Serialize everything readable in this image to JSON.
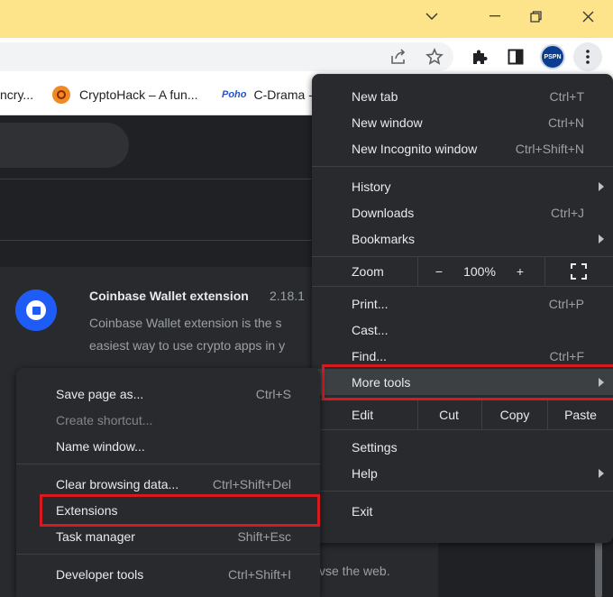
{
  "titlebar": {
    "color": "#fde48a"
  },
  "bookmarks": [
    {
      "label": "ncry..."
    },
    {
      "label": "CryptoHack – A fun..."
    },
    {
      "badge": "Poho",
      "label": "C-Drama -"
    }
  ],
  "extension": {
    "name": "Coinbase Wallet extension",
    "version": "2.18.1",
    "desc_line1": "Coinbase Wallet extension is the s",
    "desc_line2": "easiest way to use crypto apps in y",
    "bottom_text": "vse the web."
  },
  "toolbar": {
    "profile_badge": "PSPN"
  },
  "main_menu": {
    "new_tab": {
      "label": "New tab",
      "shortcut": "Ctrl+T"
    },
    "new_window": {
      "label": "New window",
      "shortcut": "Ctrl+N"
    },
    "new_incognito": {
      "label": "New Incognito window",
      "shortcut": "Ctrl+Shift+N"
    },
    "history": {
      "label": "History"
    },
    "downloads": {
      "label": "Downloads",
      "shortcut": "Ctrl+J"
    },
    "bookmarks": {
      "label": "Bookmarks"
    },
    "zoom": {
      "label": "Zoom",
      "minus": "−",
      "value": "100%",
      "plus": "+"
    },
    "print": {
      "label": "Print...",
      "shortcut": "Ctrl+P"
    },
    "cast": {
      "label": "Cast..."
    },
    "find": {
      "label": "Find...",
      "shortcut": "Ctrl+F"
    },
    "more_tools": {
      "label": "More tools"
    },
    "edit": {
      "label": "Edit",
      "cut": "Cut",
      "copy": "Copy",
      "paste": "Paste"
    },
    "settings": {
      "label": "Settings"
    },
    "help": {
      "label": "Help"
    },
    "exit": {
      "label": "Exit"
    }
  },
  "submenu": {
    "save_page": {
      "label": "Save page as...",
      "shortcut": "Ctrl+S"
    },
    "create_shortcut": {
      "label": "Create shortcut..."
    },
    "name_window": {
      "label": "Name window..."
    },
    "clear_data": {
      "label": "Clear browsing data...",
      "shortcut": "Ctrl+Shift+Del"
    },
    "extensions": {
      "label": "Extensions"
    },
    "task_manager": {
      "label": "Task manager",
      "shortcut": "Shift+Esc"
    },
    "developer_tools": {
      "label": "Developer tools",
      "shortcut": "Ctrl+Shift+I"
    }
  },
  "highlight_color": "#d71920"
}
